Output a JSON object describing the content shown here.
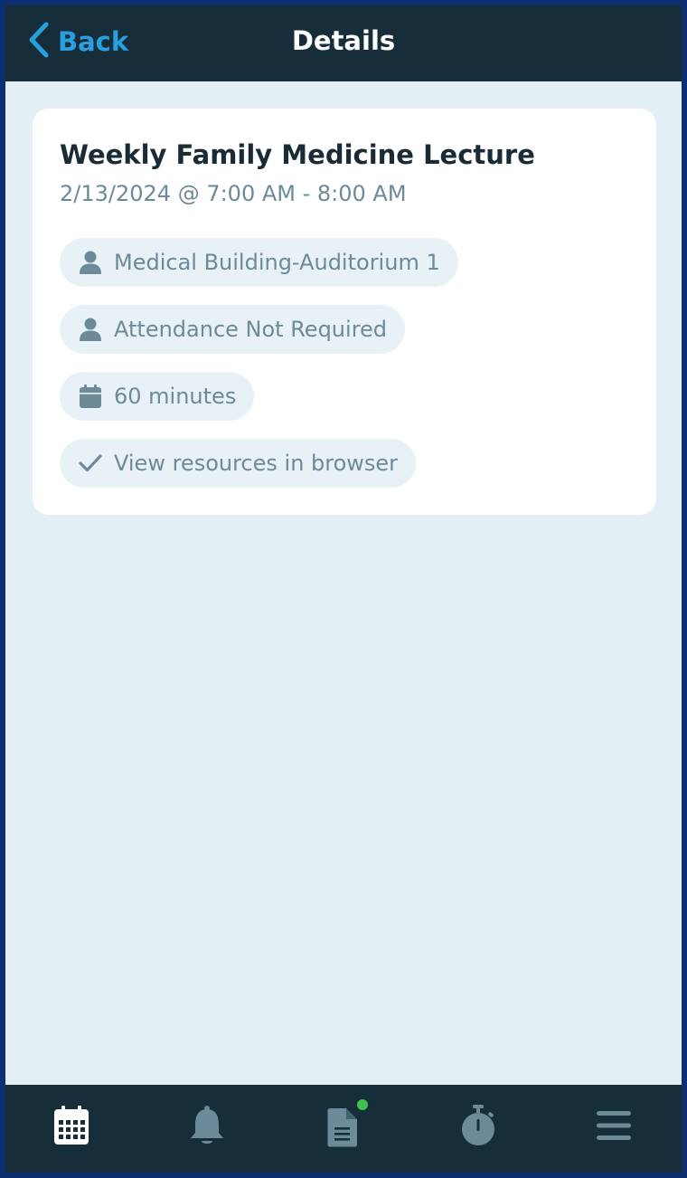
{
  "header": {
    "back_label": "Back",
    "title": "Details",
    "accent_color": "#2a9fe0"
  },
  "event": {
    "title": "Weekly Family Medicine Lecture",
    "datetime": "2/13/2024 @ 7:00 AM - 8:00 AM",
    "chips": [
      {
        "icon": "person-icon",
        "label": "Medical Building-Auditorium 1"
      },
      {
        "icon": "person-icon",
        "label": "Attendance Not Required"
      },
      {
        "icon": "calendar-icon",
        "label": "60 minutes"
      },
      {
        "icon": "checkmark-icon",
        "label": "View resources in browser"
      }
    ]
  },
  "tabbar": {
    "items": [
      {
        "icon": "calendar-icon",
        "active": true
      },
      {
        "icon": "bell-icon",
        "active": false
      },
      {
        "icon": "document-icon",
        "active": false,
        "badge_color": "#3cc24a"
      },
      {
        "icon": "stopwatch-icon",
        "active": false
      },
      {
        "icon": "menu-icon",
        "active": false
      }
    ]
  }
}
